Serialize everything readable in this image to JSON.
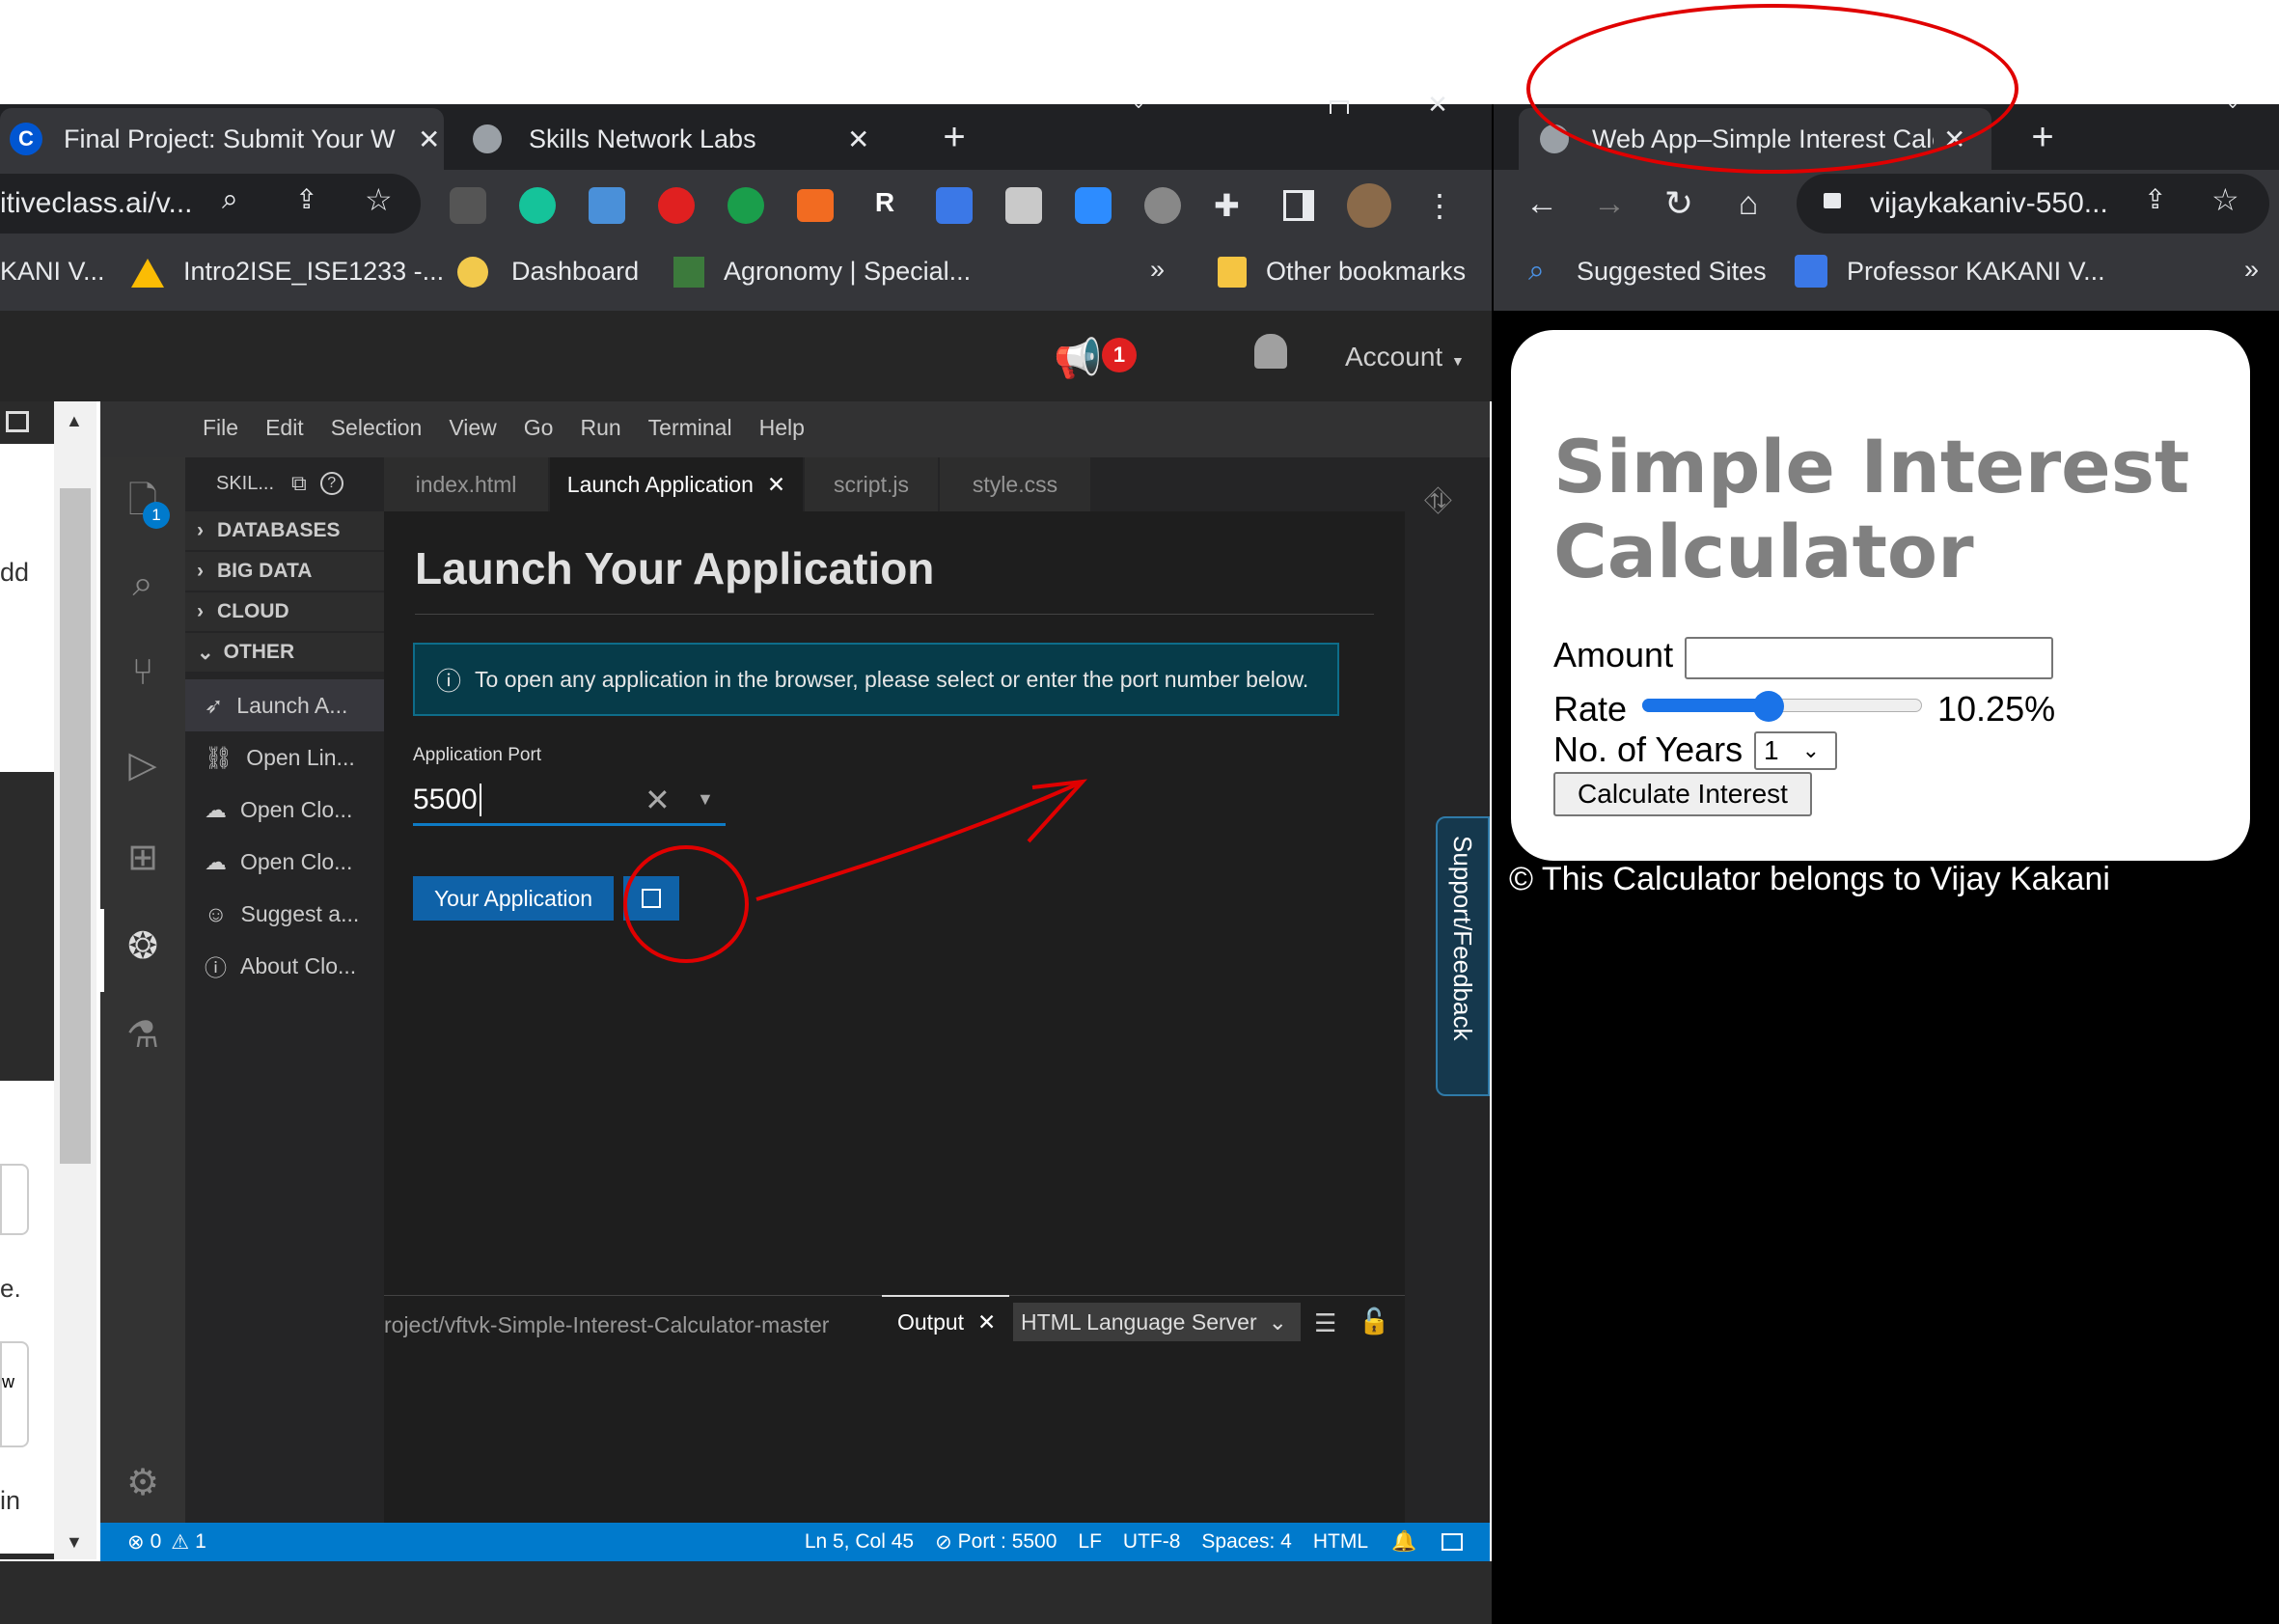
{
  "left_browser": {
    "tabs": [
      {
        "label": "Final Project: Submit Your W",
        "icon": "C"
      },
      {
        "label": "Skills Network Labs",
        "icon": "globe"
      }
    ],
    "address": "itiveclass.ai/v...",
    "bookmarks": [
      "KANI V...",
      "Intro2ISE_ISE1233 -...",
      "Dashboard",
      "Agronomy | Special..."
    ],
    "bookmarks_more": "»",
    "other_bookmarks": "Other bookmarks",
    "notification_count": "1",
    "account_label": "Account"
  },
  "left_partial": {
    "t1": "dd",
    "t2": "e.",
    "t3": "w",
    "t4": "in"
  },
  "ide": {
    "menu": [
      "File",
      "Edit",
      "Selection",
      "View",
      "Go",
      "Run",
      "Terminal",
      "Help"
    ],
    "explorer_header": "SKIL...",
    "badge": "1",
    "sections": [
      "DATABASES",
      "BIG DATA",
      "CLOUD",
      "OTHER"
    ],
    "other_items": [
      "Launch A...",
      "Open Lin...",
      "Open Clo...",
      "Open Clo...",
      "Suggest a...",
      "About Clo..."
    ],
    "tabs": [
      "index.html",
      "Launch Application",
      "script.js",
      "style.css"
    ],
    "heading": "Launch Your Application",
    "info": "To open any application in the browser, please select or enter the port number below.",
    "port_label": "Application Port",
    "port_value": "5500",
    "app_button": "Your Application",
    "feedback": "Support/Feedback",
    "panel_path": "roject/vftvk-Simple-Interest-Calculator-master",
    "panel_output": "Output",
    "panel_select": "HTML Language Server",
    "status": {
      "errors": "0",
      "warnings": "1",
      "position": "Ln 5, Col 45",
      "port": "Port : 5500",
      "eol": "LF",
      "encoding": "UTF-8",
      "spaces": "Spaces: 4",
      "lang": "HTML"
    }
  },
  "right_browser": {
    "tab": "Web App–Simple Interest Calc",
    "address": "vijaykakaniv-550...",
    "bookmarks": [
      "Suggested Sites",
      "Professor KAKANI V..."
    ],
    "bookmarks_more": "»"
  },
  "calculator": {
    "title": "Simple Interest Calculator",
    "amount_label": "Amount",
    "rate_label": "Rate",
    "rate_value": "10.25%",
    "rate_fraction": 0.45,
    "years_label": "No. of Years",
    "years_value": "1",
    "button": "Calculate Interest",
    "footer": "© This Calculator belongs to Vijay Kakani"
  }
}
